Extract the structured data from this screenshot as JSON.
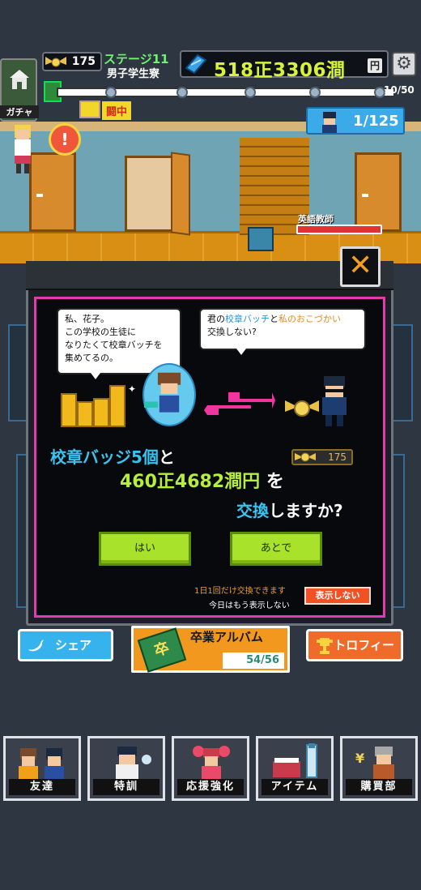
{
  "hud": {
    "badge_count": "175",
    "stage_label": "ステージ11",
    "dorm_label": "男子学生寮",
    "money_value": "518正3306澗",
    "money_unit": "円",
    "gacha_label": "ガチャ",
    "progress_count": "10/50",
    "status_label": "闘中",
    "enemy_count": "1/125"
  },
  "scene": {
    "boss_label": "英語教師",
    "alert_mark": "!"
  },
  "dialog": {
    "bubble_left": [
      "私、花子。",
      "この学校の生徒に",
      "なりたくて校章バッチを",
      "集めてるの。"
    ],
    "bubble_right_pre": "君の",
    "bubble_right_hl1": "校章バッチ",
    "bubble_right_mid": "と",
    "bubble_right_hl2": "私のおこづかい",
    "bubble_right_line2": "交換しない?",
    "question_hl": "校章バッジ5個",
    "question_to": "と",
    "question_amount": "460正4682澗円",
    "question_wo": " を",
    "question_exchange": "交換",
    "question_end": "しますか?",
    "badge_pill": "175",
    "yes_label": "はい",
    "later_label": "あとで",
    "note_once": "1日1回だけ交換できます",
    "note_today": "今日はもう表示しない",
    "hide_label": "表示しない",
    "close_glyph": "✕"
  },
  "lower": {
    "share_label": "シェア",
    "album_title": "卒業アルバム",
    "album_count": "54/56",
    "trophy_label": "トロフィー"
  },
  "nav": {
    "items": [
      {
        "label": "友達"
      },
      {
        "label": "特訓"
      },
      {
        "label": "応援強化"
      },
      {
        "label": "アイテム"
      },
      {
        "label": "購買部"
      }
    ]
  },
  "colors": {
    "accent_green": "#a8e22b",
    "frame_pink": "#e23bb1",
    "money_yellow": "#d8f23a",
    "highlight_blue": "#38c4f0"
  }
}
